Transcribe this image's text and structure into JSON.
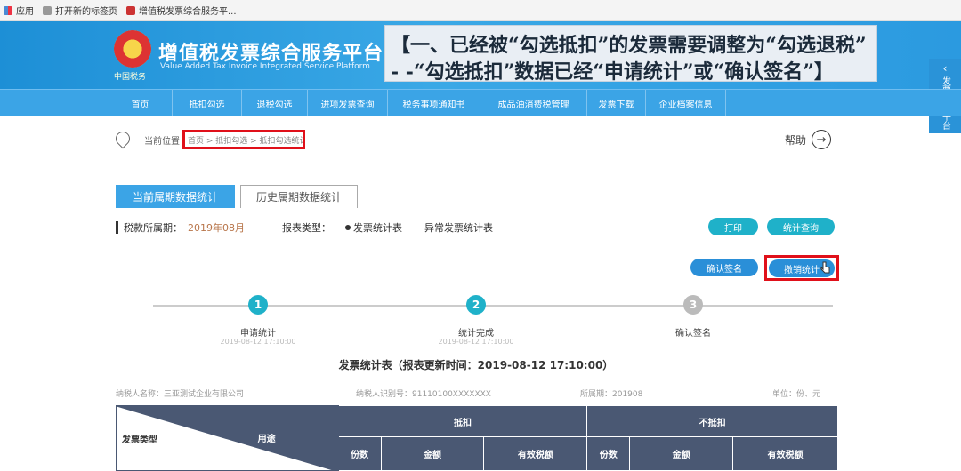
{
  "bookmarks": [
    {
      "label": "应用",
      "icon": "apps-grid-icon"
    },
    {
      "label": "打开新的标签页",
      "icon": "page-icon"
    },
    {
      "label": "增值税发票综合服务平...",
      "icon": "tax-seal-icon"
    }
  ],
  "header": {
    "title": "增值税发票综合服务平台",
    "subtitle": "Value Added Tax Invoice Integrated Service Platform",
    "emblem_caption": "中国税务",
    "banner_line1": "【一、已经被“勾选抵扣”的发票需要调整为“勾选退税”",
    "banner_line2": "- -“勾选抵扣”数据已经“申请统计”或“确认签名”】"
  },
  "side_tab": {
    "chevron": "‹",
    "label": "发票查验平台"
  },
  "nav": {
    "items": [
      "首页",
      "抵扣勾选",
      "退税勾选",
      "进项发票查询",
      "税务事项通知书",
      "成品油消费税管理",
      "发票下载",
      "企业档案信息"
    ]
  },
  "breadcrumb": {
    "label": "当前位置",
    "path": "首页 > 抵扣勾选 > 抵扣勾选统计"
  },
  "help": {
    "label": "帮助",
    "arrow": "→"
  },
  "tabs": {
    "current": "当前属期数据统计",
    "history": "历史属期数据统计"
  },
  "filter": {
    "period_label": "税款所属期：",
    "period_value": "2019年08月",
    "type_label": "报表类型：",
    "type_option1": "发票统计表",
    "type_option2": "异常发票统计表"
  },
  "buttons": {
    "print": "打印",
    "stat_query": "统计查询",
    "confirm_sign": "确认签名",
    "cancel_stat": "撤销统计"
  },
  "steps": [
    {
      "num": "1",
      "label": "申请统计",
      "sub": "2019-08-12 17:10:00",
      "color": "#1fb1c9"
    },
    {
      "num": "2",
      "label": "统计完成",
      "sub": "2019-08-12 17:10:00",
      "color": "#1fb1c9"
    },
    {
      "num": "3",
      "label": "确认签名",
      "sub": "",
      "color": "#bbbbbb"
    }
  ],
  "report": {
    "title": "发票统计表（报表更新时间：2019-08-12 17:10:00）",
    "meta": [
      "纳税人名称：三亚测试企业有限公司",
      "纳税人识别号：91110100XXXXXXX",
      "所属期：201908",
      "单位：份、元"
    ]
  },
  "table": {
    "row_header": "发票类型",
    "col_header": "用途",
    "groups": [
      "抵扣",
      "不抵扣"
    ],
    "sub_cols": [
      "份数",
      "金额",
      "有效税额",
      "份数",
      "金额",
      "有效税额"
    ]
  },
  "colors": {
    "accent": "#3ba4e6",
    "highlight": "#e0101a",
    "table_header": "#4a5873",
    "teal": "#1fb1c9"
  }
}
